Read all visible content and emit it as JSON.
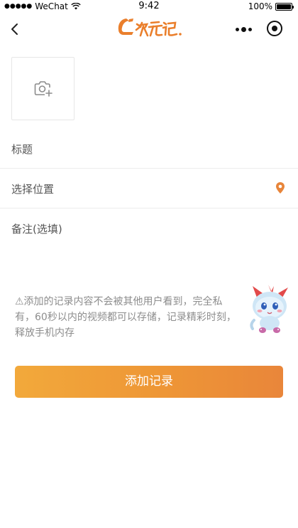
{
  "status_bar": {
    "carrier": "WeChat",
    "time": "9:42",
    "battery": "100%"
  },
  "nav": {
    "logo_text": "次元记.",
    "icons": [
      "back-chevron-icon",
      "more-dots-icon",
      "target-circle-icon"
    ]
  },
  "form": {
    "photo_icon": "camera-add-icon",
    "title_placeholder": "标题",
    "location_label": "选择位置",
    "location_icon": "map-pin-icon",
    "note_placeholder": "备注(选填)"
  },
  "notice": {
    "text": "⚠添加的记录内容不会被其他用户看到，完全私有，60秒以内的视频都可以存储，记录精彩时刻，释放手机内存"
  },
  "submit": {
    "label": "添加记录"
  },
  "colors": {
    "accent": "#ee9636",
    "pin": "#e8853a"
  }
}
